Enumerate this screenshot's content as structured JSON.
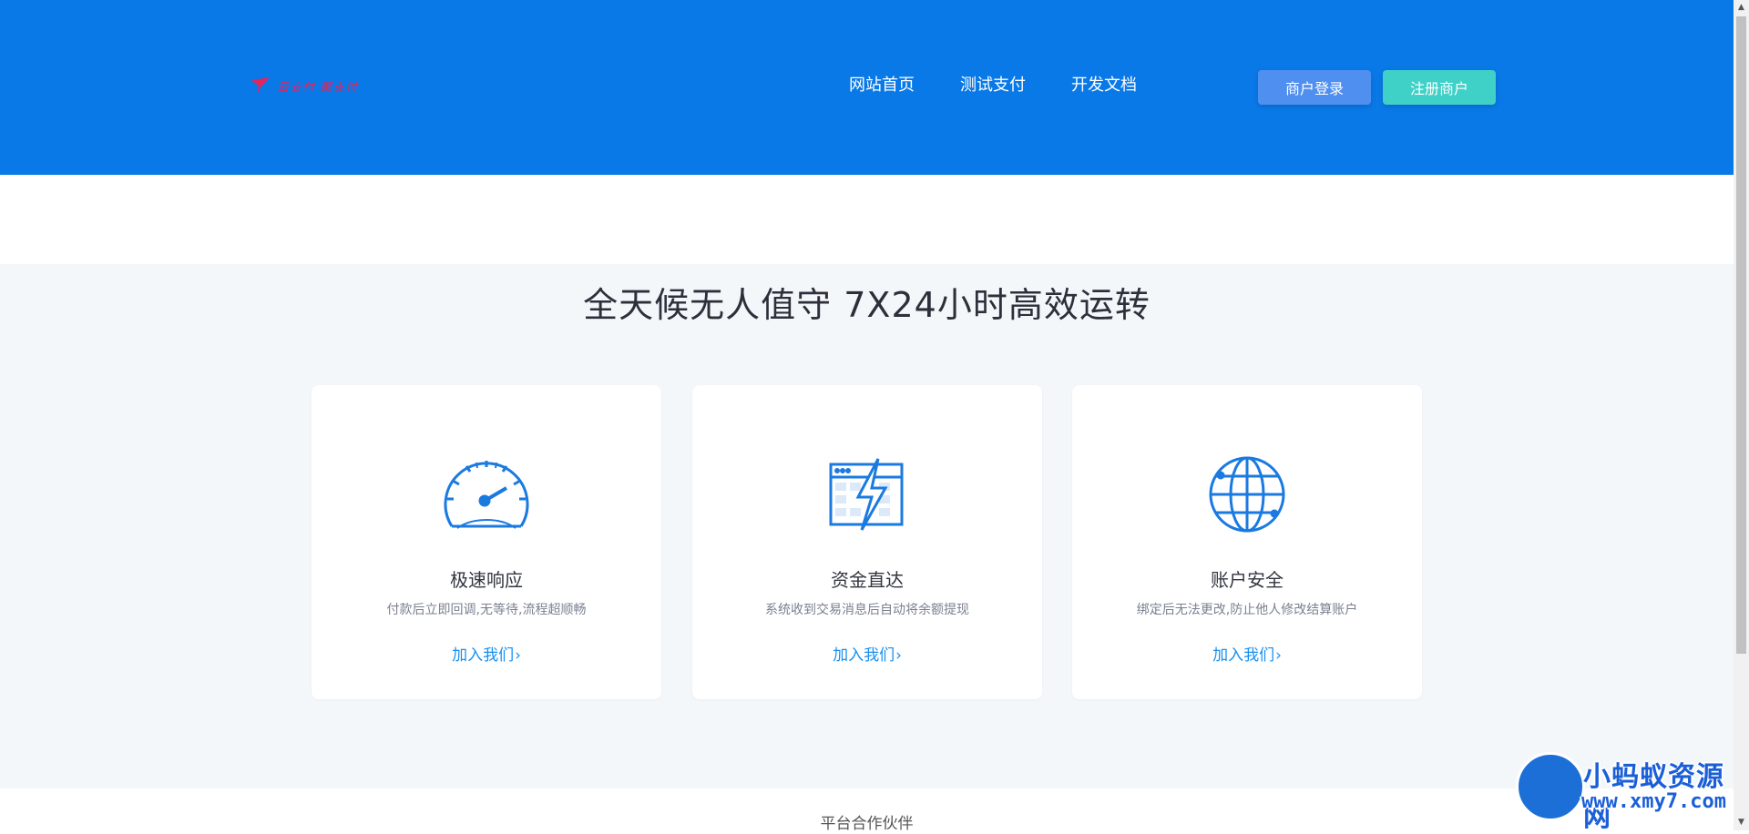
{
  "header": {
    "logo": {
      "text": "云支付 聚支付",
      "icon": "paper-plane-icon"
    },
    "nav": [
      {
        "label": "网站首页"
      },
      {
        "label": "测试支付"
      },
      {
        "label": "开发文档"
      }
    ],
    "login_label": "商户登录",
    "register_label": "注册商户",
    "colors": {
      "background": "#0979e8",
      "login": "#4f8ff0",
      "register": "#3fd1c7"
    }
  },
  "features": {
    "title": "全天候无人值守 7X24小时高效运转",
    "cards": [
      {
        "icon": "speedometer-icon",
        "title": "极速响应",
        "desc": "付款后立即回调,无等待,流程超顺畅",
        "link": "加入我们"
      },
      {
        "icon": "lightning-window-icon",
        "title": "资金直达",
        "desc": "系统收到交易消息后自动将余额提现",
        "link": "加入我们"
      },
      {
        "icon": "globe-icon",
        "title": "账户安全",
        "desc": "绑定后无法更改,防止他人修改结算账户",
        "link": "加入我们"
      }
    ]
  },
  "partners": {
    "title": "平台合作伙伴"
  },
  "watermark": {
    "title": "小蚂蚁资源网",
    "url": "www.xmy7.com"
  }
}
